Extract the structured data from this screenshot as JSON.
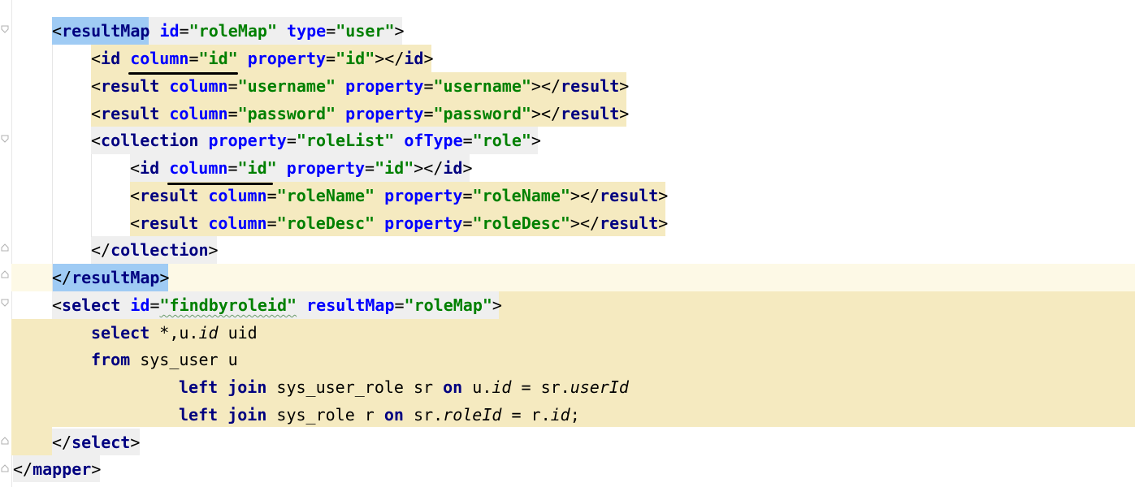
{
  "editor": {
    "lines": [
      [
        {
          "t": "<",
          "c": "br"
        },
        {
          "t": "resultMap",
          "c": "tag"
        },
        {
          "t": " ",
          "c": "plain"
        },
        {
          "t": "id",
          "c": "attr"
        },
        {
          "t": "=",
          "c": "op"
        },
        {
          "t": "\"roleMap\"",
          "c": "val"
        },
        {
          "t": " ",
          "c": "plain"
        },
        {
          "t": "type",
          "c": "attr"
        },
        {
          "t": "=",
          "c": "op"
        },
        {
          "t": "\"user\"",
          "c": "val"
        },
        {
          "t": ">",
          "c": "br"
        }
      ],
      [
        {
          "t": "<",
          "c": "br"
        },
        {
          "t": "id",
          "c": "tag"
        },
        {
          "t": " ",
          "c": "plain"
        },
        {
          "t": "column",
          "c": "attr"
        },
        {
          "t": "=",
          "c": "op"
        },
        {
          "t": "\"id\"",
          "c": "val"
        },
        {
          "t": " ",
          "c": "plain"
        },
        {
          "t": "property",
          "c": "attr"
        },
        {
          "t": "=",
          "c": "op"
        },
        {
          "t": "\"id\"",
          "c": "val"
        },
        {
          "t": "></",
          "c": "br"
        },
        {
          "t": "id",
          "c": "tag"
        },
        {
          "t": ">",
          "c": "br"
        }
      ],
      [
        {
          "t": "<",
          "c": "br"
        },
        {
          "t": "result",
          "c": "tag"
        },
        {
          "t": " ",
          "c": "plain"
        },
        {
          "t": "column",
          "c": "attr"
        },
        {
          "t": "=",
          "c": "op"
        },
        {
          "t": "\"username\"",
          "c": "val"
        },
        {
          "t": " ",
          "c": "plain"
        },
        {
          "t": "property",
          "c": "attr"
        },
        {
          "t": "=",
          "c": "op"
        },
        {
          "t": "\"username\"",
          "c": "val"
        },
        {
          "t": "></",
          "c": "br"
        },
        {
          "t": "result",
          "c": "tag"
        },
        {
          "t": ">",
          "c": "br"
        }
      ],
      [
        {
          "t": "<",
          "c": "br"
        },
        {
          "t": "result",
          "c": "tag"
        },
        {
          "t": " ",
          "c": "plain"
        },
        {
          "t": "column",
          "c": "attr"
        },
        {
          "t": "=",
          "c": "op"
        },
        {
          "t": "\"password\"",
          "c": "val"
        },
        {
          "t": " ",
          "c": "plain"
        },
        {
          "t": "property",
          "c": "attr"
        },
        {
          "t": "=",
          "c": "op"
        },
        {
          "t": "\"password\"",
          "c": "val"
        },
        {
          "t": "></",
          "c": "br"
        },
        {
          "t": "result",
          "c": "tag"
        },
        {
          "t": ">",
          "c": "br"
        }
      ],
      [
        {
          "t": "<",
          "c": "br"
        },
        {
          "t": "collection",
          "c": "tag"
        },
        {
          "t": " ",
          "c": "plain"
        },
        {
          "t": "property",
          "c": "attr"
        },
        {
          "t": "=",
          "c": "op"
        },
        {
          "t": "\"roleList\"",
          "c": "val"
        },
        {
          "t": " ",
          "c": "plain"
        },
        {
          "t": "ofType",
          "c": "attr"
        },
        {
          "t": "=",
          "c": "op"
        },
        {
          "t": "\"role\"",
          "c": "val"
        },
        {
          "t": ">",
          "c": "br"
        }
      ],
      [
        {
          "t": "<",
          "c": "br"
        },
        {
          "t": "id",
          "c": "tag"
        },
        {
          "t": " ",
          "c": "plain"
        },
        {
          "t": "column",
          "c": "attr"
        },
        {
          "t": "=",
          "c": "op"
        },
        {
          "t": "\"id\"",
          "c": "val"
        },
        {
          "t": " ",
          "c": "plain"
        },
        {
          "t": "property",
          "c": "attr"
        },
        {
          "t": "=",
          "c": "op"
        },
        {
          "t": "\"id\"",
          "c": "val"
        },
        {
          "t": "></",
          "c": "br"
        },
        {
          "t": "id",
          "c": "tag"
        },
        {
          "t": ">",
          "c": "br"
        }
      ],
      [
        {
          "t": "<",
          "c": "br"
        },
        {
          "t": "result",
          "c": "tag"
        },
        {
          "t": " ",
          "c": "plain"
        },
        {
          "t": "column",
          "c": "attr"
        },
        {
          "t": "=",
          "c": "op"
        },
        {
          "t": "\"roleName\"",
          "c": "val"
        },
        {
          "t": " ",
          "c": "plain"
        },
        {
          "t": "property",
          "c": "attr"
        },
        {
          "t": "=",
          "c": "op"
        },
        {
          "t": "\"roleName\"",
          "c": "val"
        },
        {
          "t": "></",
          "c": "br"
        },
        {
          "t": "result",
          "c": "tag"
        },
        {
          "t": ">",
          "c": "br"
        }
      ],
      [
        {
          "t": "<",
          "c": "br"
        },
        {
          "t": "result",
          "c": "tag"
        },
        {
          "t": " ",
          "c": "plain"
        },
        {
          "t": "column",
          "c": "attr"
        },
        {
          "t": "=",
          "c": "op"
        },
        {
          "t": "\"roleDesc\"",
          "c": "val"
        },
        {
          "t": " ",
          "c": "plain"
        },
        {
          "t": "property",
          "c": "attr"
        },
        {
          "t": "=",
          "c": "op"
        },
        {
          "t": "\"roleDesc\"",
          "c": "val"
        },
        {
          "t": "></",
          "c": "br"
        },
        {
          "t": "result",
          "c": "tag"
        },
        {
          "t": ">",
          "c": "br"
        }
      ],
      [
        {
          "t": "</",
          "c": "br"
        },
        {
          "t": "collection",
          "c": "tag"
        },
        {
          "t": ">",
          "c": "br"
        }
      ],
      [
        {
          "t": "</",
          "c": "br"
        },
        {
          "t": "resultMap",
          "c": "tag"
        },
        {
          "t": ">",
          "c": "br"
        }
      ],
      [
        {
          "t": "<",
          "c": "br"
        },
        {
          "t": "select",
          "c": "tag"
        },
        {
          "t": " ",
          "c": "plain"
        },
        {
          "t": "id",
          "c": "attr"
        },
        {
          "t": "=",
          "c": "op"
        },
        {
          "t": "\"findbyroleid\"",
          "c": "val",
          "wavy": true
        },
        {
          "t": " ",
          "c": "plain"
        },
        {
          "t": "resultMap",
          "c": "attr"
        },
        {
          "t": "=",
          "c": "op"
        },
        {
          "t": "\"roleMap\"",
          "c": "val"
        },
        {
          "t": ">",
          "c": "br"
        }
      ],
      [
        {
          "t": "select",
          "c": "kw"
        },
        {
          "t": " *,u.",
          "c": "plain"
        },
        {
          "t": "id",
          "c": "ital"
        },
        {
          "t": " uid",
          "c": "plain"
        }
      ],
      [
        {
          "t": "from",
          "c": "kw"
        },
        {
          "t": " sys_user u",
          "c": "plain"
        }
      ],
      [
        {
          "t": "left",
          "c": "kw"
        },
        {
          "t": " ",
          "c": "plain"
        },
        {
          "t": "join",
          "c": "kw"
        },
        {
          "t": " sys_user_role sr ",
          "c": "plain"
        },
        {
          "t": "on",
          "c": "kw"
        },
        {
          "t": " u.",
          "c": "plain"
        },
        {
          "t": "id",
          "c": "ital"
        },
        {
          "t": " = sr.",
          "c": "plain"
        },
        {
          "t": "userId",
          "c": "ital"
        }
      ],
      [
        {
          "t": "left",
          "c": "kw"
        },
        {
          "t": " ",
          "c": "plain"
        },
        {
          "t": "join",
          "c": "kw"
        },
        {
          "t": " sys_role r ",
          "c": "plain"
        },
        {
          "t": "on",
          "c": "kw"
        },
        {
          "t": " sr.",
          "c": "plain"
        },
        {
          "t": "roleId",
          "c": "ital"
        },
        {
          "t": " = r.",
          "c": "plain"
        },
        {
          "t": "id",
          "c": "ital"
        },
        {
          "t": ";",
          "c": "plain"
        }
      ],
      [
        {
          "t": "</",
          "c": "br"
        },
        {
          "t": "select",
          "c": "tag"
        },
        {
          "t": ">",
          "c": "br"
        }
      ],
      [
        {
          "t": "</",
          "c": "br"
        },
        {
          "t": "mapper",
          "c": "tag"
        },
        {
          "t": ">",
          "c": "br"
        }
      ]
    ]
  },
  "colors": {
    "tag": "#000080",
    "attribute": "#0000ff",
    "value": "#008000",
    "selection": "#f5eac0",
    "brace_match": "#9fcbf4",
    "caret_line": "#fdf9e6"
  }
}
